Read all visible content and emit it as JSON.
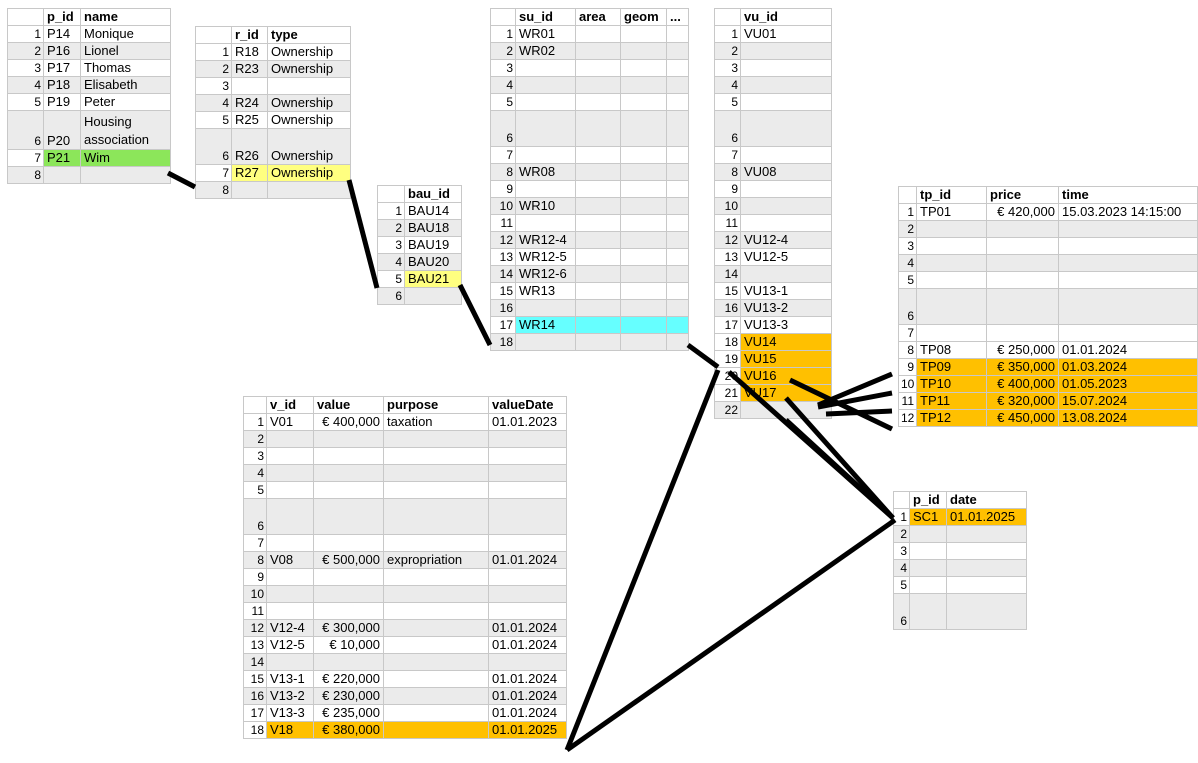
{
  "tables": {
    "persons": {
      "headers": [
        "p_id",
        "name"
      ],
      "rows": [
        {
          "n": "1",
          "cells": [
            "P14",
            "Monique"
          ]
        },
        {
          "n": "2",
          "cells": [
            "P16",
            "Lionel"
          ]
        },
        {
          "n": "3",
          "cells": [
            "P17",
            "Thomas"
          ]
        },
        {
          "n": "4",
          "cells": [
            "P18",
            "Elisabeth"
          ]
        },
        {
          "n": "5",
          "cells": [
            "P19",
            "Peter"
          ]
        },
        {
          "n": "6",
          "cells": [
            "P20",
            "Housing association"
          ]
        },
        {
          "n": "7",
          "cells": [
            "P21",
            "Wim"
          ]
        },
        {
          "n": "8",
          "cells": [
            "",
            ""
          ]
        }
      ]
    },
    "rights": {
      "headers": [
        "r_id",
        "type"
      ],
      "rows": [
        {
          "n": "1",
          "cells": [
            "R18",
            "Ownership"
          ]
        },
        {
          "n": "2",
          "cells": [
            "R23",
            "Ownership"
          ]
        },
        {
          "n": "3",
          "cells": [
            "",
            ""
          ]
        },
        {
          "n": "4",
          "cells": [
            "R24",
            "Ownership"
          ]
        },
        {
          "n": "5",
          "cells": [
            "R25",
            "Ownership"
          ]
        },
        {
          "n": "6",
          "cells": [
            "R26",
            "Ownership"
          ]
        },
        {
          "n": "7",
          "cells": [
            "R27",
            "Ownership"
          ]
        },
        {
          "n": "8",
          "cells": [
            "",
            ""
          ]
        }
      ]
    },
    "baunits": {
      "headers": [
        "bau_id"
      ],
      "rows": [
        {
          "n": "1",
          "cells": [
            "BAU14"
          ]
        },
        {
          "n": "2",
          "cells": [
            "BAU18"
          ]
        },
        {
          "n": "3",
          "cells": [
            "BAU19"
          ]
        },
        {
          "n": "4",
          "cells": [
            "BAU20"
          ]
        },
        {
          "n": "5",
          "cells": [
            "BAU21"
          ]
        },
        {
          "n": "6",
          "cells": [
            ""
          ]
        }
      ]
    },
    "spatial_units": {
      "headers": [
        "su_id",
        "area",
        "geom",
        "..."
      ],
      "rows": [
        {
          "n": "1",
          "cells": [
            "WR01",
            "",
            "",
            ""
          ]
        },
        {
          "n": "2",
          "cells": [
            "WR02",
            "",
            "",
            ""
          ]
        },
        {
          "n": "3",
          "cells": [
            "",
            "",
            "",
            ""
          ]
        },
        {
          "n": "4",
          "cells": [
            "",
            "",
            "",
            ""
          ]
        },
        {
          "n": "5",
          "cells": [
            "",
            "",
            "",
            ""
          ]
        },
        {
          "n": "6",
          "cells": [
            "",
            "",
            "",
            ""
          ]
        },
        {
          "n": "7",
          "cells": [
            "",
            "",
            "",
            ""
          ]
        },
        {
          "n": "8",
          "cells": [
            "WR08",
            "",
            "",
            ""
          ]
        },
        {
          "n": "9",
          "cells": [
            "",
            "",
            "",
            ""
          ]
        },
        {
          "n": "10",
          "cells": [
            "WR10",
            "",
            "",
            ""
          ]
        },
        {
          "n": "11",
          "cells": [
            "",
            "",
            "",
            ""
          ]
        },
        {
          "n": "12",
          "cells": [
            "WR12-4",
            "",
            "",
            ""
          ]
        },
        {
          "n": "13",
          "cells": [
            "WR12-5",
            "",
            "",
            ""
          ]
        },
        {
          "n": "14",
          "cells": [
            "WR12-6",
            "",
            "",
            ""
          ]
        },
        {
          "n": "15",
          "cells": [
            "WR13",
            "",
            "",
            ""
          ]
        },
        {
          "n": "16",
          "cells": [
            "",
            "",
            "",
            ""
          ]
        },
        {
          "n": "17",
          "cells": [
            "WR14",
            "",
            "",
            ""
          ]
        },
        {
          "n": "18",
          "cells": [
            "",
            "",
            "",
            ""
          ]
        }
      ]
    },
    "valuation_units": {
      "headers": [
        "vu_id"
      ],
      "rows": [
        {
          "n": "1",
          "cells": [
            "VU01"
          ]
        },
        {
          "n": "2",
          "cells": [
            ""
          ]
        },
        {
          "n": "3",
          "cells": [
            ""
          ]
        },
        {
          "n": "4",
          "cells": [
            ""
          ]
        },
        {
          "n": "5",
          "cells": [
            ""
          ]
        },
        {
          "n": "6",
          "cells": [
            ""
          ]
        },
        {
          "n": "7",
          "cells": [
            ""
          ]
        },
        {
          "n": "8",
          "cells": [
            "VU08"
          ]
        },
        {
          "n": "9",
          "cells": [
            ""
          ]
        },
        {
          "n": "10",
          "cells": [
            ""
          ]
        },
        {
          "n": "11",
          "cells": [
            ""
          ]
        },
        {
          "n": "12",
          "cells": [
            "VU12-4"
          ]
        },
        {
          "n": "13",
          "cells": [
            "VU12-5"
          ]
        },
        {
          "n": "14",
          "cells": [
            ""
          ]
        },
        {
          "n": "15",
          "cells": [
            "VU13-1"
          ]
        },
        {
          "n": "16",
          "cells": [
            "VU13-2"
          ]
        },
        {
          "n": "17",
          "cells": [
            "VU13-3"
          ]
        },
        {
          "n": "18",
          "cells": [
            "VU14"
          ]
        },
        {
          "n": "19",
          "cells": [
            "VU15"
          ]
        },
        {
          "n": "20",
          "cells": [
            "VU16"
          ]
        },
        {
          "n": "21",
          "cells": [
            "VU17"
          ]
        },
        {
          "n": "22",
          "cells": [
            ""
          ]
        }
      ]
    },
    "transaction_prices": {
      "headers": [
        "tp_id",
        "price",
        "time"
      ],
      "rows": [
        {
          "n": "1",
          "cells": [
            "TP01",
            "€ 420,000",
            "15.03.2023 14:15:00"
          ]
        },
        {
          "n": "2",
          "cells": [
            "",
            "",
            ""
          ]
        },
        {
          "n": "3",
          "cells": [
            "",
            "",
            ""
          ]
        },
        {
          "n": "4",
          "cells": [
            "",
            "",
            ""
          ]
        },
        {
          "n": "5",
          "cells": [
            "",
            "",
            ""
          ]
        },
        {
          "n": "6",
          "cells": [
            "",
            "",
            ""
          ]
        },
        {
          "n": "7",
          "cells": [
            "",
            "",
            ""
          ]
        },
        {
          "n": "8",
          "cells": [
            "TP08",
            "€ 250,000",
            "01.01.2024"
          ]
        },
        {
          "n": "9",
          "cells": [
            "TP09",
            "€ 350,000",
            "01.03.2024"
          ]
        },
        {
          "n": "10",
          "cells": [
            "TP10",
            "€ 400,000",
            "01.05.2023"
          ]
        },
        {
          "n": "11",
          "cells": [
            "TP11",
            "€ 320,000",
            "15.07.2024"
          ]
        },
        {
          "n": "12",
          "cells": [
            "TP12",
            "€ 450,000",
            "13.08.2024"
          ]
        }
      ]
    },
    "valuations": {
      "headers": [
        "v_id",
        "value",
        "purpose",
        "valueDate"
      ],
      "rows": [
        {
          "n": "1",
          "cells": [
            "V01",
            "€ 400,000",
            "taxation",
            "01.01.2023"
          ]
        },
        {
          "n": "2",
          "cells": [
            "",
            "",
            "",
            ""
          ]
        },
        {
          "n": "3",
          "cells": [
            "",
            "",
            "",
            ""
          ]
        },
        {
          "n": "4",
          "cells": [
            "",
            "",
            "",
            ""
          ]
        },
        {
          "n": "5",
          "cells": [
            "",
            "",
            "",
            ""
          ]
        },
        {
          "n": "6",
          "cells": [
            "",
            "",
            "",
            ""
          ]
        },
        {
          "n": "7",
          "cells": [
            "",
            "",
            "",
            ""
          ]
        },
        {
          "n": "8",
          "cells": [
            "V08",
            "€ 500,000",
            "expropriation",
            "01.01.2024"
          ]
        },
        {
          "n": "9",
          "cells": [
            "",
            "",
            "",
            ""
          ]
        },
        {
          "n": "10",
          "cells": [
            "",
            "",
            "",
            ""
          ]
        },
        {
          "n": "11",
          "cells": [
            "",
            "",
            "",
            ""
          ]
        },
        {
          "n": "12",
          "cells": [
            "V12-4",
            "€ 300,000",
            "",
            "01.01.2024"
          ]
        },
        {
          "n": "13",
          "cells": [
            "V12-5",
            "€ 10,000",
            "",
            "01.01.2024"
          ]
        },
        {
          "n": "14",
          "cells": [
            "",
            "",
            "",
            ""
          ]
        },
        {
          "n": "15",
          "cells": [
            "V13-1",
            "€ 220,000",
            "",
            "01.01.2024"
          ]
        },
        {
          "n": "16",
          "cells": [
            "V13-2",
            "€ 230,000",
            "",
            "01.01.2024"
          ]
        },
        {
          "n": "17",
          "cells": [
            "V13-3",
            "€ 235,000",
            "",
            "01.01.2024"
          ]
        },
        {
          "n": "18",
          "cells": [
            "V18",
            "€ 380,000",
            "",
            "01.01.2025"
          ]
        }
      ]
    },
    "sales_contracts": {
      "headers": [
        "p_id",
        "date"
      ],
      "rows": [
        {
          "n": "1",
          "cells": [
            "SC1",
            "01.01.2025"
          ]
        },
        {
          "n": "2",
          "cells": [
            "",
            ""
          ]
        },
        {
          "n": "3",
          "cells": [
            "",
            ""
          ]
        },
        {
          "n": "4",
          "cells": [
            "",
            ""
          ]
        },
        {
          "n": "5",
          "cells": [
            "",
            ""
          ]
        },
        {
          "n": "6",
          "cells": [
            "",
            ""
          ]
        }
      ]
    }
  },
  "highlight_colors": {
    "green": "#8ce65a",
    "yellow": "#ffff80",
    "cyan": "#66ffff",
    "orange": "#ffc000"
  },
  "link_color": "#000000"
}
